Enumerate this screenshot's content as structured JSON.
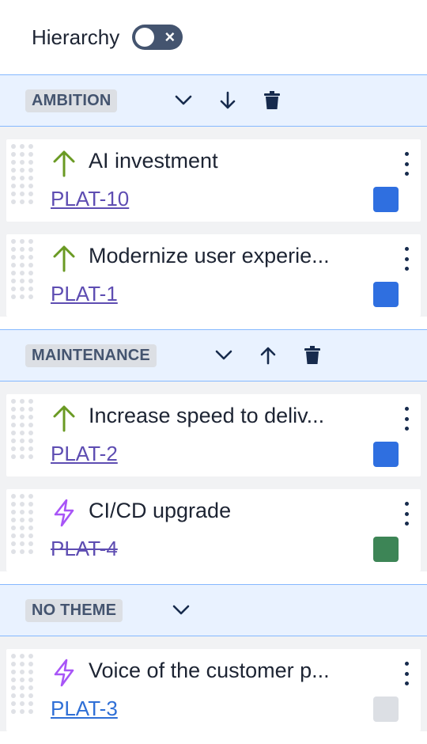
{
  "header": {
    "title": "Hierarchy",
    "toggle_state": "off"
  },
  "groups": [
    {
      "label": "AMBITION",
      "actions": [
        "chevron-down-icon",
        "arrow-down-icon",
        "trash-icon"
      ],
      "cards": [
        {
          "icon": "arrow-up-icon",
          "title": "AI investment",
          "key": "PLAT-10",
          "key_color": "#5e4db2",
          "done": false,
          "swatch": "#2f6fe0"
        },
        {
          "icon": "arrow-up-icon",
          "title": "Modernize user experie...",
          "key": "PLAT-1",
          "key_color": "#5e4db2",
          "done": false,
          "swatch": "#2f6fe0"
        }
      ]
    },
    {
      "label": "MAINTENANCE",
      "actions": [
        "chevron-down-icon",
        "arrow-up-icon",
        "trash-icon"
      ],
      "cards": [
        {
          "icon": "arrow-up-icon",
          "title": "Increase speed to deliv...",
          "key": "PLAT-2",
          "key_color": "#5e4db2",
          "done": false,
          "swatch": "#2f6fe0"
        },
        {
          "icon": "lightning-icon",
          "title": "CI/CD upgrade",
          "key": "PLAT-4",
          "key_color": "#5e4db2",
          "done": true,
          "swatch": "#3d8556"
        }
      ]
    },
    {
      "label": "NO THEME",
      "actions": [
        "chevron-down-icon"
      ],
      "cards": [
        {
          "icon": "lightning-icon",
          "title": "Voice of the customer p...",
          "key": "PLAT-3",
          "key_color": "#2f6fd6",
          "done": false,
          "swatch": "#dcdfe4"
        }
      ]
    }
  ],
  "colors": {
    "header_bg": "#e9f2ff",
    "header_border": "#85b8ff",
    "body_bg": "#f1f2f4",
    "arrow_icon": "#6a9a23",
    "lightning_icon": "#a855f7"
  }
}
